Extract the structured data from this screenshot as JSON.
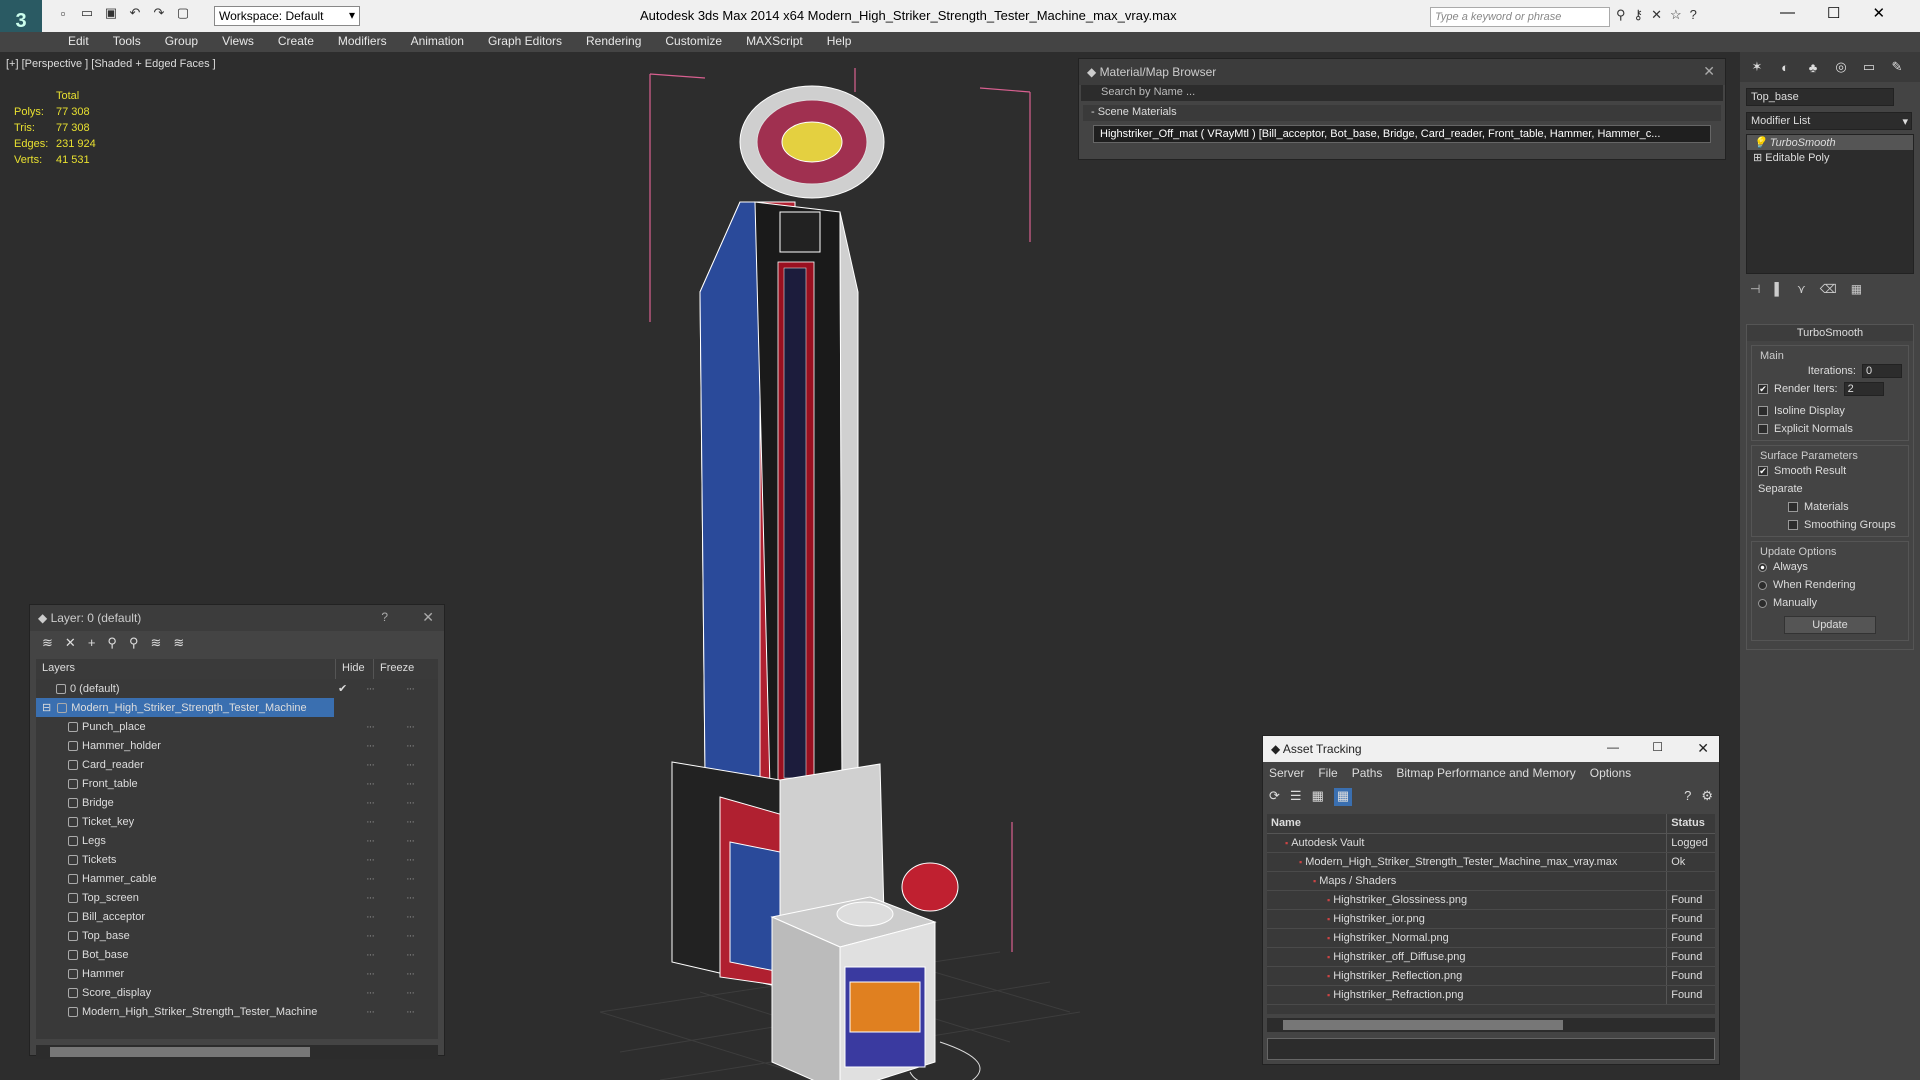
{
  "app": {
    "title": "Autodesk 3ds Max  2014 x64     Modern_High_Striker_Strength_Tester_Machine_max_vray.max",
    "workspace": "Workspace: Default",
    "search_placeholder": "Type a keyword or phrase"
  },
  "menu": [
    "Edit",
    "Tools",
    "Group",
    "Views",
    "Create",
    "Modifiers",
    "Animation",
    "Graph Editors",
    "Rendering",
    "Customize",
    "MAXScript",
    "Help"
  ],
  "viewport": {
    "label": "[+] [Perspective ] [Shaded + Edged Faces ]",
    "stats": {
      "header": "Total",
      "rows": [
        {
          "label": "Polys:",
          "value": "77 308"
        },
        {
          "label": "Tris:",
          "value": "77 308"
        },
        {
          "label": "Edges:",
          "value": "231 924"
        },
        {
          "label": "Verts:",
          "value": "41 531"
        }
      ]
    }
  },
  "material_browser": {
    "title": "Material/Map Browser",
    "search": "Search by Name ...",
    "section": "- Scene Materials",
    "material": "Highstriker_Off_mat  ( VRayMtl ) [Bill_acceptor, Bot_base, Bridge, Card_reader, Front_table, Hammer, Hammer_c..."
  },
  "command_panel": {
    "object_name": "Top_base",
    "modifier_list": "Modifier List",
    "stack": [
      "TurboSmooth",
      "Editable Poly"
    ],
    "rollout_title": "TurboSmooth",
    "main_label": "Main",
    "iterations_label": "Iterations:",
    "iterations_value": "0",
    "render_iters_label": "Render Iters:",
    "render_iters_value": "2",
    "isoline": "Isoline Display",
    "explicit_normals": "Explicit Normals",
    "surface_params": "Surface Parameters",
    "smooth_result": "Smooth Result",
    "separate": "Separate",
    "materials": "Materials",
    "smoothing_groups": "Smoothing Groups",
    "update_options": "Update Options",
    "always": "Always",
    "when_rendering": "When Rendering",
    "manually": "Manually",
    "update_button": "Update"
  },
  "layers": {
    "title": "Layer: 0 (default)",
    "help": "?",
    "columns": [
      "Layers",
      "Hide",
      "Freeze"
    ],
    "default_layer": "0 (default)",
    "selected_layer": "Modern_High_Striker_Strength_Tester_Machine",
    "objects": [
      "Punch_place",
      "Hammer_holder",
      "Card_reader",
      "Front_table",
      "Bridge",
      "Ticket_key",
      "Legs",
      "Tickets",
      "Hammer_cable",
      "Top_screen",
      "Bill_acceptor",
      "Top_base",
      "Bot_base",
      "Hammer",
      "Score_display",
      "Modern_High_Striker_Strength_Tester_Machine"
    ]
  },
  "asset_tracking": {
    "title": "Asset Tracking",
    "menu": [
      "Server",
      "File",
      "Paths",
      "Bitmap Performance and Memory",
      "Options"
    ],
    "columns": [
      "Name",
      "Status"
    ],
    "rows": [
      {
        "name": "Autodesk Vault",
        "status": "Logged",
        "indent": 1
      },
      {
        "name": "Modern_High_Striker_Strength_Tester_Machine_max_vray.max",
        "status": "Ok",
        "indent": 2
      },
      {
        "name": "Maps / Shaders",
        "status": "",
        "indent": 3
      },
      {
        "name": "Highstriker_Glossiness.png",
        "status": "Found",
        "indent": 4
      },
      {
        "name": "Highstriker_ior.png",
        "status": "Found",
        "indent": 4
      },
      {
        "name": "Highstriker_Normal.png",
        "status": "Found",
        "indent": 4
      },
      {
        "name": "Highstriker_off_Diffuse.png",
        "status": "Found",
        "indent": 4
      },
      {
        "name": "Highstriker_Reflection.png",
        "status": "Found",
        "indent": 4
      },
      {
        "name": "Highstriker_Refraction.png",
        "status": "Found",
        "indent": 4
      }
    ]
  }
}
